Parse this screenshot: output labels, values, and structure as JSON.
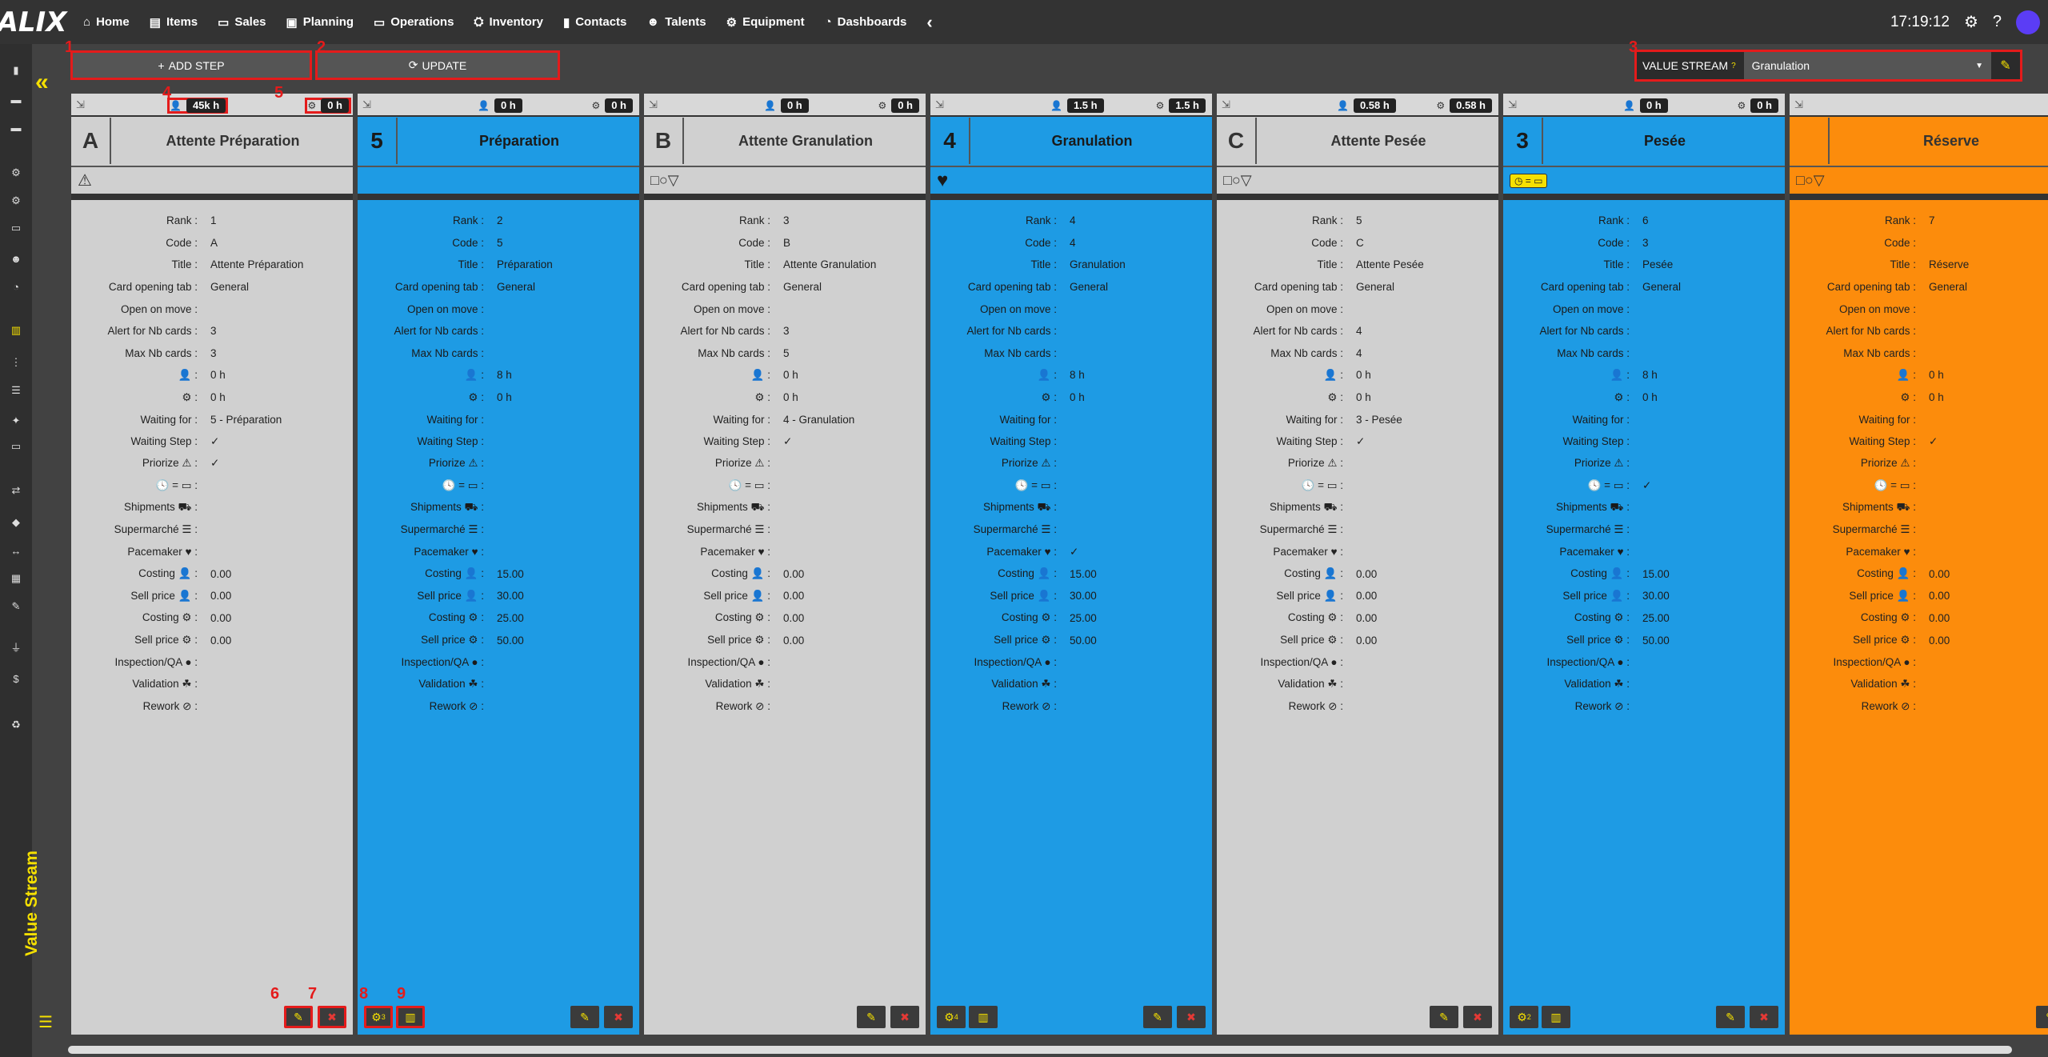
{
  "nav": {
    "logo": "ALIX",
    "items": [
      {
        "label": "Home",
        "icon": "home-icon"
      },
      {
        "label": "Items",
        "icon": "book-icon"
      },
      {
        "label": "Sales",
        "icon": "money-icon"
      },
      {
        "label": "Planning",
        "icon": "clipboard-icon"
      },
      {
        "label": "Operations",
        "icon": "monitor-icon"
      },
      {
        "label": "Inventory",
        "icon": "inventory-icon"
      },
      {
        "label": "Contacts",
        "icon": "contact-icon"
      },
      {
        "label": "Talents",
        "icon": "users-icon"
      },
      {
        "label": "Equipment",
        "icon": "gears-icon"
      },
      {
        "label": "Dashboards",
        "icon": "gauge-icon"
      }
    ],
    "collapse_glyph": "‹",
    "clock": "17:19:12"
  },
  "toolbar": {
    "add_step": "ADD STEP",
    "update": "UPDATE",
    "vs_label": "VALUE STREAM",
    "vs_selected": "Granulation"
  },
  "markers": [
    "1",
    "2",
    "3",
    "4",
    "5",
    "6",
    "7",
    "8",
    "9"
  ],
  "sidebar_title": "Value Stream",
  "labels": {
    "rank": "Rank :",
    "code": "Code :",
    "title": "Title :",
    "tab": "Card opening tab :",
    "openmove": "Open on move :",
    "alert": "Alert for Nb cards :",
    "max": "Max Nb cards :",
    "person": ":",
    "gears": ":",
    "waitfor": "Waiting for :",
    "waitstep": "Waiting Step :",
    "priorize": "Priorize",
    "clockcal": "=",
    "shipments": "Shipments",
    "supermarche": "Supermarché",
    "pacemaker": "Pacemaker",
    "costing1": "Costing",
    "sell1": "Sell price",
    "costing2": "Costing",
    "sell2": "Sell price",
    "inspection": "Inspection/QA",
    "validation": "Validation",
    "rework": "Rework"
  },
  "columns": [
    {
      "theme": "grey",
      "pill_person": "45k h",
      "pill_gears": "0 h",
      "code": "A",
      "title": "Attente Préparation",
      "icon": "warning-icon",
      "footer": "edit-delete",
      "values": {
        "rank": "1",
        "code": "A",
        "title": "Attente Préparation",
        "tab": "General",
        "openmove": "",
        "alert": "3",
        "max": "3",
        "person": "0 h",
        "gears": "0 h",
        "waitfor": "5 - Préparation",
        "waitstep": "✓",
        "priorize": "✓",
        "clockcal": "",
        "shipments": "",
        "supermarche": "",
        "pacemaker": "",
        "costing1": "0.00",
        "sell1": "0.00",
        "costing2": "0.00",
        "sell2": "0.00",
        "inspection": "",
        "validation": "",
        "rework": ""
      }
    },
    {
      "theme": "blue",
      "pill_person": "0 h",
      "pill_gears": "0 h",
      "code": "5",
      "title": "Préparation",
      "icon": "",
      "footer": "gears-board",
      "gear_count": "3",
      "values": {
        "rank": "2",
        "code": "5",
        "title": "Préparation",
        "tab": "General",
        "openmove": "",
        "alert": "",
        "max": "",
        "person": "8 h",
        "gears": "0 h",
        "waitfor": "",
        "waitstep": "",
        "priorize": "",
        "clockcal": "",
        "shipments": "",
        "supermarche": "",
        "pacemaker": "",
        "costing1": "15.00",
        "sell1": "30.00",
        "costing2": "25.00",
        "sell2": "50.00",
        "inspection": "",
        "validation": "",
        "rework": ""
      }
    },
    {
      "theme": "grey",
      "pill_person": "0 h",
      "pill_gears": "0 h",
      "code": "B",
      "title": "Attente Granulation",
      "icon": "shapes-icon",
      "footer": "edit-delete",
      "values": {
        "rank": "3",
        "code": "B",
        "title": "Attente Granulation",
        "tab": "General",
        "openmove": "",
        "alert": "3",
        "max": "5",
        "person": "0 h",
        "gears": "0 h",
        "waitfor": "4 - Granulation",
        "waitstep": "✓",
        "priorize": "",
        "clockcal": "",
        "shipments": "",
        "supermarche": "",
        "pacemaker": "",
        "costing1": "0.00",
        "sell1": "0.00",
        "costing2": "0.00",
        "sell2": "0.00",
        "inspection": "",
        "validation": "",
        "rework": ""
      }
    },
    {
      "theme": "blue",
      "pill_person": "1.5 h",
      "pill_gears": "1.5 h",
      "code": "4",
      "title": "Granulation",
      "icon": "heart-icon",
      "footer": "gears-board",
      "gear_count": "4",
      "values": {
        "rank": "4",
        "code": "4",
        "title": "Granulation",
        "tab": "General",
        "openmove": "",
        "alert": "",
        "max": "",
        "person": "8 h",
        "gears": "0 h",
        "waitfor": "",
        "waitstep": "",
        "priorize": "",
        "clockcal": "",
        "shipments": "",
        "supermarche": "",
        "pacemaker": "✓",
        "costing1": "15.00",
        "sell1": "30.00",
        "costing2": "25.00",
        "sell2": "50.00",
        "inspection": "",
        "validation": "",
        "rework": ""
      }
    },
    {
      "theme": "grey",
      "pill_person": "0.58 h",
      "pill_gears": "0.58 h",
      "code": "C",
      "title": "Attente Pesée",
      "icon": "shapes-icon",
      "footer": "edit-delete",
      "values": {
        "rank": "5",
        "code": "C",
        "title": "Attente Pesée",
        "tab": "General",
        "openmove": "",
        "alert": "4",
        "max": "4",
        "person": "0 h",
        "gears": "0 h",
        "waitfor": "3 - Pesée",
        "waitstep": "✓",
        "priorize": "",
        "clockcal": "",
        "shipments": "",
        "supermarche": "",
        "pacemaker": "",
        "costing1": "0.00",
        "sell1": "0.00",
        "costing2": "0.00",
        "sell2": "0.00",
        "inspection": "",
        "validation": "",
        "rework": ""
      }
    },
    {
      "theme": "blue",
      "pill_person": "0 h",
      "pill_gears": "0 h",
      "code": "3",
      "title": "Pesée",
      "icon": "clock-cal-icon",
      "footer": "gears-board",
      "gear_count": "2",
      "values": {
        "rank": "6",
        "code": "3",
        "title": "Pesée",
        "tab": "General",
        "openmove": "",
        "alert": "",
        "max": "",
        "person": "8 h",
        "gears": "0 h",
        "waitfor": "",
        "waitstep": "",
        "priorize": "",
        "clockcal": "✓",
        "shipments": "",
        "supermarche": "",
        "pacemaker": "",
        "costing1": "15.00",
        "sell1": "30.00",
        "costing2": "25.00",
        "sell2": "50.00",
        "inspection": "",
        "validation": "",
        "rework": ""
      }
    },
    {
      "theme": "orange",
      "pill_person": "",
      "pill_gears": "",
      "code": "",
      "title": "Réserve",
      "icon": "shapes-icon",
      "footer": "edit-only",
      "values": {
        "rank": "7",
        "code": "",
        "title": "Réserve",
        "tab": "General",
        "openmove": "",
        "alert": "",
        "max": "",
        "person": "0 h",
        "gears": "0 h",
        "waitfor": "",
        "waitstep": "✓",
        "priorize": "",
        "clockcal": "",
        "shipments": "",
        "supermarche": "",
        "pacemaker": "",
        "costing1": "0.00",
        "sell1": "0.00",
        "costing2": "0.00",
        "sell2": "0.00",
        "inspection": "",
        "validation": "",
        "rework": ""
      }
    }
  ]
}
